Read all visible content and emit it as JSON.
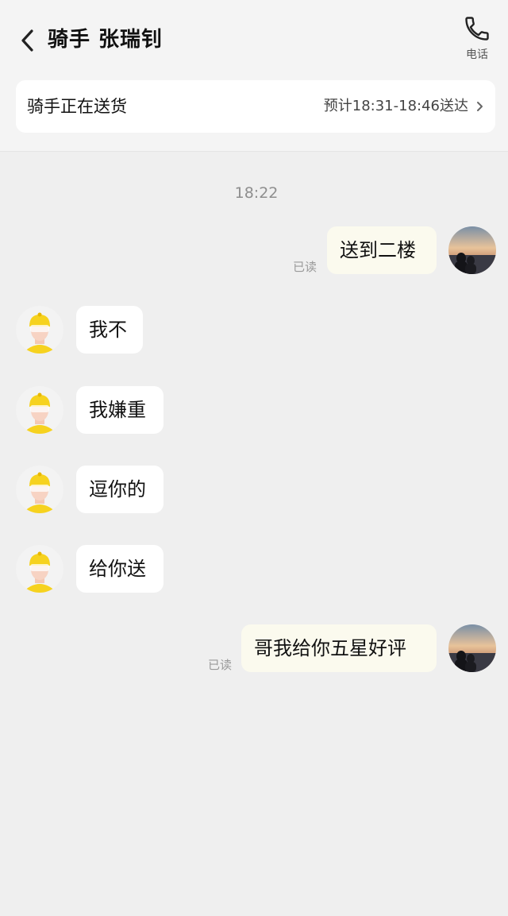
{
  "header": {
    "title": "骑手 张瑞钊",
    "phone_label": "电话"
  },
  "status_card": {
    "status": "骑手正在送货",
    "eta": "预计18:31-18:46送达"
  },
  "chat": {
    "timestamp": "18:22",
    "messages": [
      {
        "from": "me",
        "text": "送到二楼",
        "read": "已读"
      },
      {
        "from": "rider",
        "text": "我不"
      },
      {
        "from": "rider",
        "text": "我嫌重"
      },
      {
        "from": "rider",
        "text": "逗你的"
      },
      {
        "from": "rider",
        "text": "给你送"
      },
      {
        "from": "me",
        "text": "哥我给你五星好评",
        "read": "已读"
      }
    ]
  },
  "colors": {
    "background": "#efefef",
    "incoming_bubble": "#ffffff",
    "outgoing_bubble": "#fbfaee",
    "rider_yellow": "#f6d21f"
  }
}
